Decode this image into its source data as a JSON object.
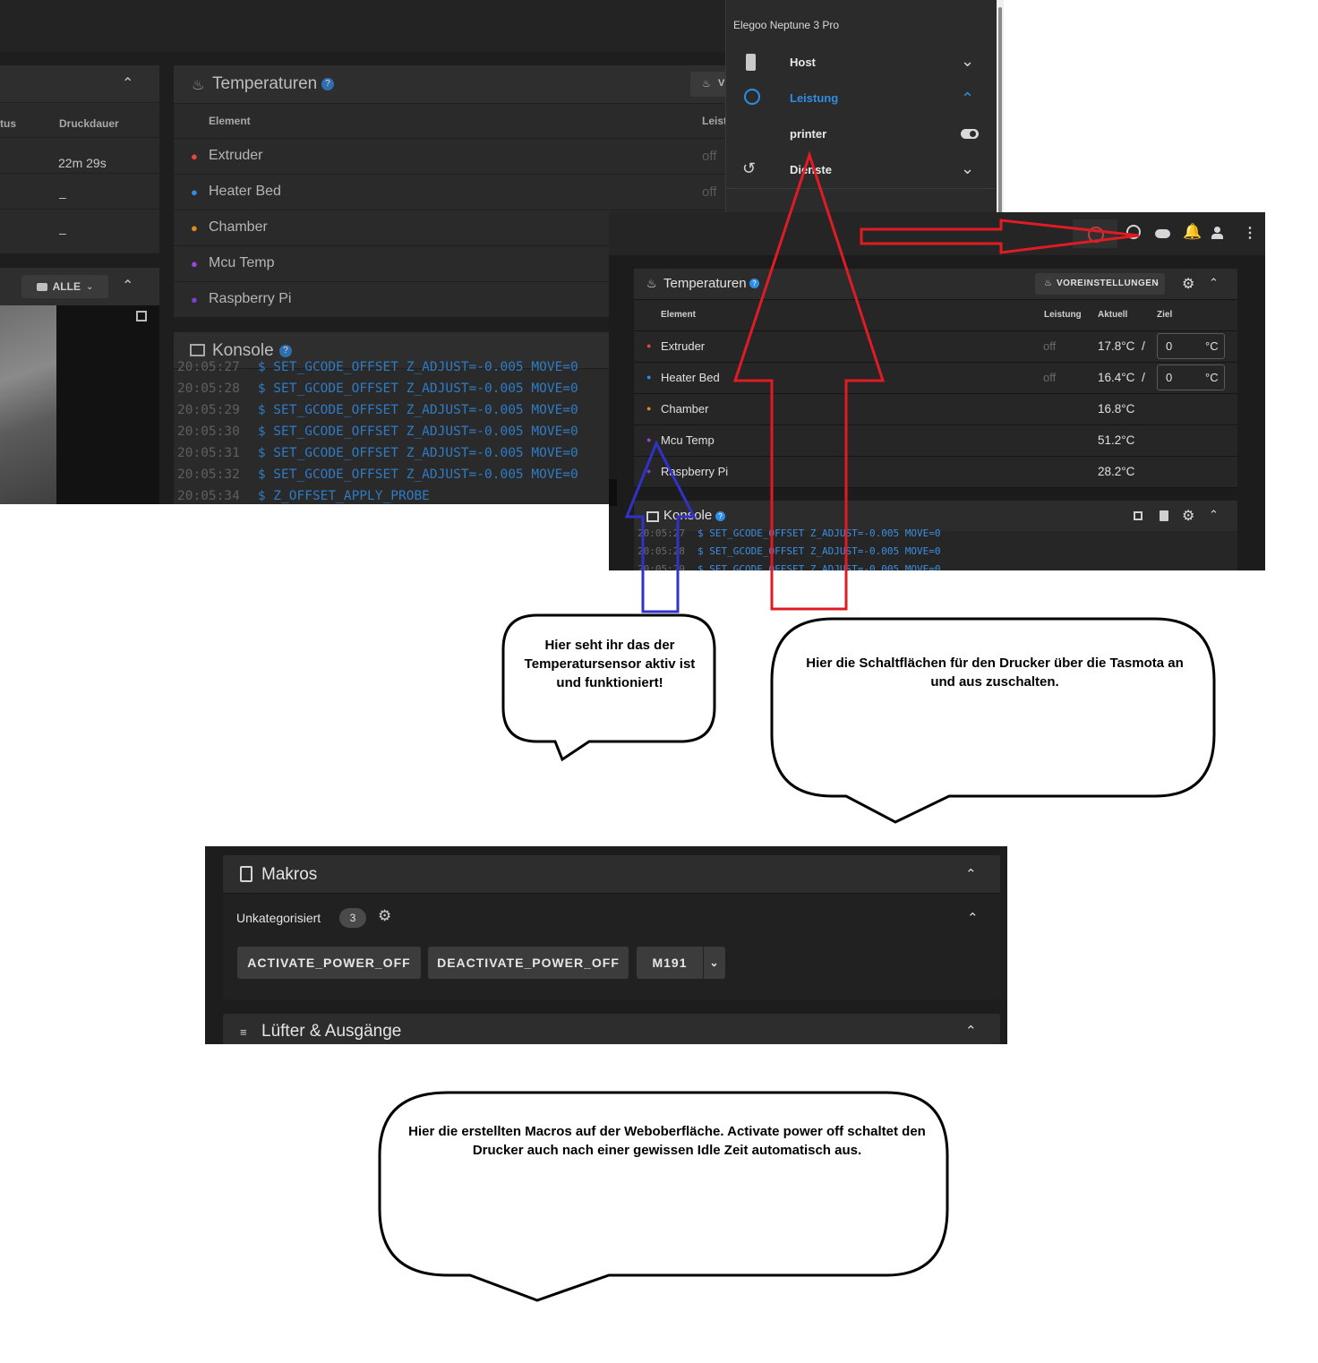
{
  "shot1": {
    "jobs_table": {
      "col_status": "tus",
      "col_duration": "Druckdauer",
      "rows": [
        "22m 29s",
        "–",
        "–"
      ]
    },
    "webcam": {
      "filter_label": "ALLE"
    },
    "temperatures": {
      "title": "Temperaturen",
      "presets_label_partial": "V",
      "col_element": "Element",
      "col_power": "Leist",
      "rows": [
        {
          "name": "Extruder",
          "power": "off",
          "color": "#e2493a"
        },
        {
          "name": "Heater Bed",
          "power": "off",
          "color": "#2f8de4"
        },
        {
          "name": "Chamber",
          "power": "",
          "color": "#e08a1e"
        },
        {
          "name": "Mcu Temp",
          "power": "",
          "color": "#9b45d8"
        },
        {
          "name": "Raspberry Pi",
          "power": "",
          "color": "#7a3fc7"
        }
      ]
    },
    "console": {
      "title": "Konsole",
      "lines": [
        {
          "time": "20:05:27",
          "cmd": "$ SET_GCODE_OFFSET Z_ADJUST=-0.005 MOVE=0"
        },
        {
          "time": "20:05:28",
          "cmd": "$ SET_GCODE_OFFSET Z_ADJUST=-0.005 MOVE=0"
        },
        {
          "time": "20:05:29",
          "cmd": "$ SET_GCODE_OFFSET Z_ADJUST=-0.005 MOVE=0"
        },
        {
          "time": "20:05:30",
          "cmd": "$ SET_GCODE_OFFSET Z_ADJUST=-0.005 MOVE=0"
        },
        {
          "time": "20:05:31",
          "cmd": "$ SET_GCODE_OFFSET Z_ADJUST=-0.005 MOVE=0"
        },
        {
          "time": "20:05:32",
          "cmd": "$ SET_GCODE_OFFSET Z_ADJUST=-0.005 MOVE=0"
        },
        {
          "time": "20:05:34",
          "cmd": "$ Z_OFFSET_APPLY_PROBE"
        }
      ]
    }
  },
  "menu": {
    "printer_name": "Elegoo Neptune 3 Pro",
    "items": [
      {
        "label": "Host",
        "icon": "server-icon",
        "expanded": false
      },
      {
        "label": "Leistung",
        "icon": "power-icon",
        "expanded": true
      },
      {
        "label": "printer",
        "icon": "",
        "toggle": true
      },
      {
        "label": "Dienste",
        "icon": "restart-icon",
        "expanded": false
      }
    ]
  },
  "shot2": {
    "temperatures": {
      "title": "Temperaturen",
      "presets_button": "VOREINSTELLUNGEN",
      "col_element": "Element",
      "col_power": "Leistung",
      "col_current": "Aktuell",
      "col_target": "Ziel",
      "rows": [
        {
          "name": "Extruder",
          "power": "off",
          "current": "17.8°C",
          "target": "0",
          "unit": "°C",
          "color": "#e2493a"
        },
        {
          "name": "Heater Bed",
          "power": "off",
          "current": "16.4°C",
          "target": "0",
          "unit": "°C",
          "color": "#2f8de4"
        },
        {
          "name": "Chamber",
          "power": "",
          "current": "16.8°C",
          "target": "",
          "unit": "",
          "color": "#e08a1e"
        },
        {
          "name": "Mcu Temp",
          "power": "",
          "current": "51.2°C",
          "target": "",
          "unit": "",
          "color": "#9b45d8"
        },
        {
          "name": "Raspberry Pi",
          "power": "",
          "current": "28.2°C",
          "target": "",
          "unit": "",
          "color": "#7a3fc7"
        }
      ]
    },
    "console": {
      "title": "Konsole",
      "lines": [
        {
          "time": "20:05:27",
          "cmd": "$ SET_GCODE_OFFSET Z_ADJUST=-0.005 MOVE=0"
        },
        {
          "time": "20:05:28",
          "cmd": "$ SET_GCODE_OFFSET Z_ADJUST=-0.005 MOVE=0"
        },
        {
          "time": "20:05:29",
          "cmd": "$ SET_GCODE_OFFSET Z_ADJUST=-0.005 MOVE=0"
        }
      ]
    }
  },
  "macros": {
    "title": "Makros",
    "group_label": "Unkategorisiert",
    "group_count": "3",
    "buttons": [
      "ACTIVATE_POWER_OFF",
      "DEACTIVATE_POWER_OFF",
      "M191"
    ],
    "next_panel": "Lüfter & Ausgänge"
  },
  "bubbles": {
    "sensor": "Hier seht ihr das der Temperatursensor aktiv ist und funktioniert!",
    "tasmota": "Hier die Schaltflächen für den Drucker über die Tasmota an und aus zuschalten.",
    "macros": "Hier die erstellten Macros auf der Weboberfläche. Activate power off schaltet den Drucker auch nach einer gewissen Idle Zeit automatisch aus."
  },
  "colors": {
    "accent_blue": "#2f8de4",
    "annotation_red": "#e01b24",
    "annotation_blue": "#3232c8"
  }
}
